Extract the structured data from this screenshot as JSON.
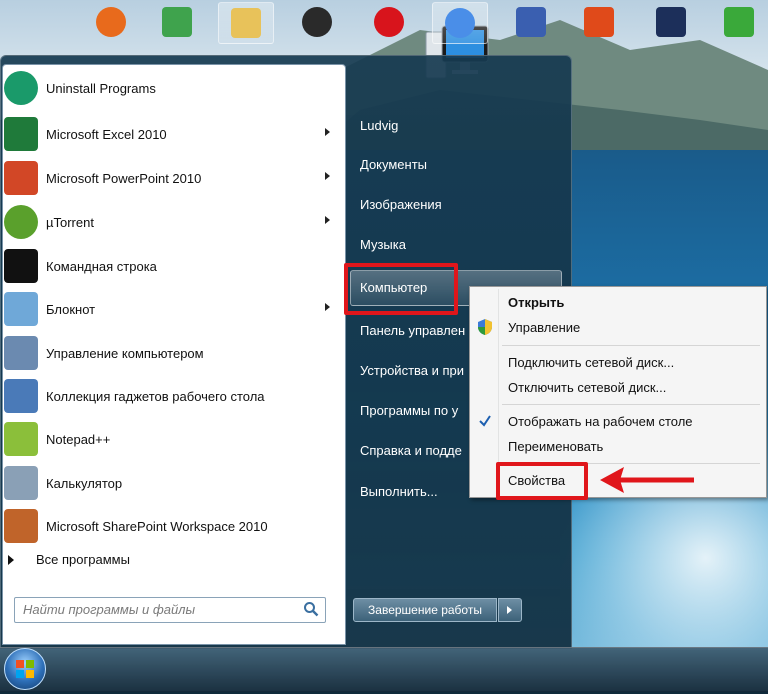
{
  "start_menu": {
    "programs": [
      {
        "label": "Uninstall Programs",
        "icon": "uninstall-icon",
        "arrow": false
      },
      {
        "label": "Microsoft Excel 2010",
        "icon": "excel-icon",
        "arrow": true
      },
      {
        "label": "Microsoft PowerPoint 2010",
        "icon": "powerpoint-icon",
        "arrow": true
      },
      {
        "label": "µTorrent",
        "icon": "utorrent-icon",
        "arrow": true
      },
      {
        "label": "Командная строка",
        "icon": "cmd-icon",
        "arrow": false
      },
      {
        "label": "Блокнот",
        "icon": "notepad-icon",
        "arrow": true
      },
      {
        "label": "Управление компьютером",
        "icon": "computer-management-icon",
        "arrow": false
      },
      {
        "label": "Коллекция гаджетов рабочего стола",
        "icon": "gadgets-icon",
        "arrow": false
      },
      {
        "label": "Notepad++",
        "icon": "notepadpp-icon",
        "arrow": false
      },
      {
        "label": "Калькулятор",
        "icon": "calculator-icon",
        "arrow": false
      },
      {
        "label": "Microsoft SharePoint Workspace 2010",
        "icon": "sharepoint-icon",
        "arrow": false
      }
    ],
    "all_programs": "Все программы",
    "search_placeholder": "Найти программы и файлы",
    "right_items": [
      "Ludvig",
      "Документы",
      "Изображения",
      "Музыка",
      "Компьютер",
      "Панель управлен",
      "Устройства и при",
      "Программы по у",
      "Справка и подде",
      "Выполнить..."
    ],
    "shutdown_label": "Завершение работы"
  },
  "context_menu": {
    "items": [
      {
        "label": "Открыть",
        "bold": true
      },
      {
        "label": "Управление",
        "shield": true
      },
      {
        "label": "Подключить сетевой диск..."
      },
      {
        "label": "Отключить сетевой диск..."
      },
      {
        "label": "Отображать на рабочем столе",
        "checked": true
      },
      {
        "label": "Переименовать"
      },
      {
        "label": "Свойства"
      }
    ]
  },
  "taskbar": {
    "apps": [
      "firefox-icon",
      "shield-app-icon",
      "explorer-icon",
      "angry-bird-icon",
      "opera-icon",
      "chrome-icon",
      "paint-icon",
      "burn-icon",
      "photoshop-icon",
      "camtasia-icon"
    ]
  },
  "colors": {
    "highlight_red": "#e0161b",
    "menu_bg": "#ffffff"
  }
}
